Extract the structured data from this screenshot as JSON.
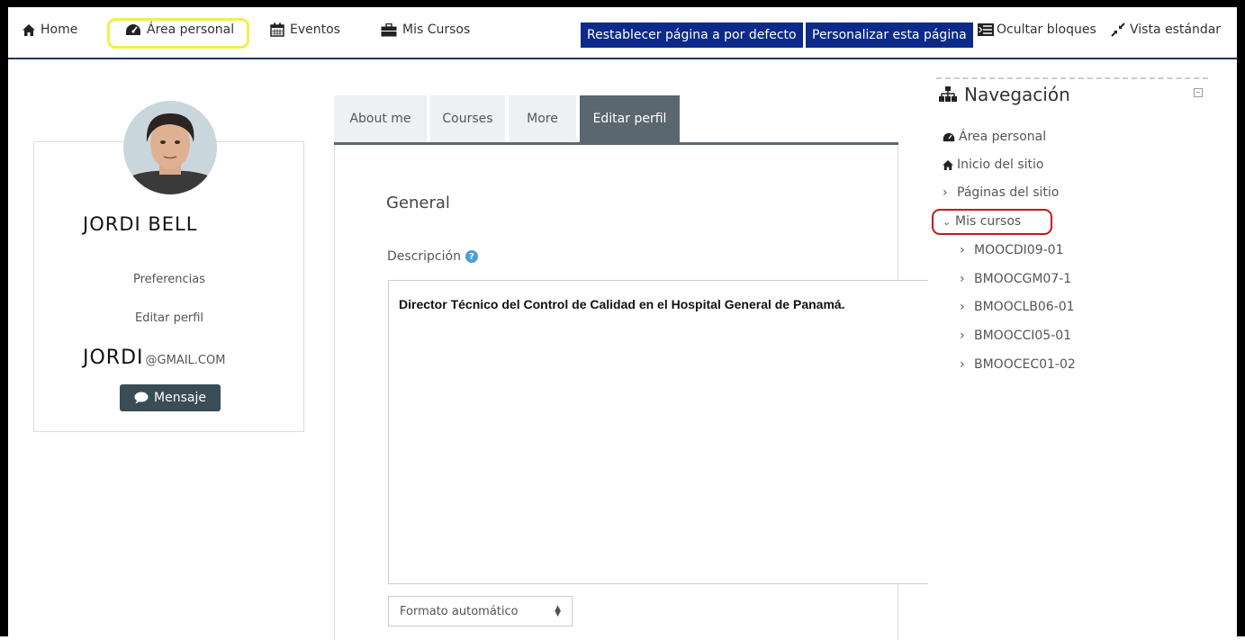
{
  "topnav": {
    "home": "Home",
    "area_personal": "Área personal",
    "eventos": "Eventos",
    "mis_cursos": "Mis Cursos",
    "reset_button": "Restablecer página a por defecto",
    "customize_button": "Personalizar esta página",
    "hide_blocks": "Ocultar bloques",
    "standard_view": "Vista estándar"
  },
  "profile": {
    "name": "JORDI BELL",
    "preferences": "Preferencias",
    "edit_profile": "Editar perfil",
    "email_user": "JORDI",
    "email_domain": "@GMAIL.COM",
    "message_button": "Mensaje"
  },
  "tabs": [
    "About me",
    "Courses",
    "More",
    "Editar perfil"
  ],
  "form": {
    "section_title": "General",
    "description_label": "Descripción",
    "description_text": "Director Técnico del Control de Calidad en el Hospital General de Panamá.",
    "format_select": "Formato automático"
  },
  "navigation": {
    "title": "Navegación",
    "items": {
      "area_personal": "Área personal",
      "inicio": "Inicio del sitio",
      "paginas": "Páginas del sitio",
      "mis_cursos": "Mis cursos"
    },
    "courses": [
      "MOOCDI09-01",
      "BMOOCGM07-1",
      "BMOOCLB06-01",
      "BMOOCCI05-01",
      "BMOOCEC01-02"
    ]
  }
}
